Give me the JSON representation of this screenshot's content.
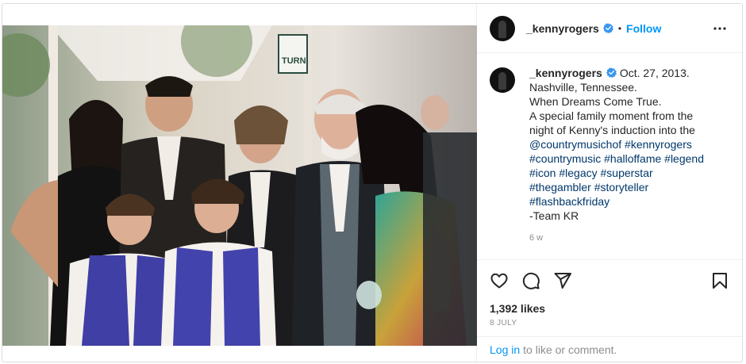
{
  "post": {
    "username": "_kennyrogers",
    "follow_label": "Follow",
    "separator": "•",
    "caption": {
      "date": "Oct. 27, 2013.",
      "lines": [
        "Nashville, Tennessee.",
        "When Dreams Come True.",
        "A special family moment from the",
        "night of Kenny's induction into the"
      ],
      "hashtag_lines": [
        "@countrymusichof #kennyrogers",
        "#countrymusic #halloffame #legend",
        "#icon #legacy #superstar",
        "#thegambler #storyteller",
        "#flashbackfriday"
      ],
      "signature": "-Team KR",
      "time_ago": "6 w"
    },
    "likes": "1,392 likes",
    "date_posted": "8 JULY",
    "login_link": "Log in",
    "login_suffix": "to like or comment.",
    "photo_sign_text": "TURN"
  },
  "colors": {
    "link": "#0095f6",
    "hashtag": "#00376b",
    "muted": "#8e8e8e",
    "verified": "#3897f0"
  },
  "icons": {
    "more": "more-options-icon",
    "like": "heart-icon",
    "comment": "comment-icon",
    "share": "share-icon",
    "save": "bookmark-icon",
    "verified": "verified-badge-icon"
  }
}
